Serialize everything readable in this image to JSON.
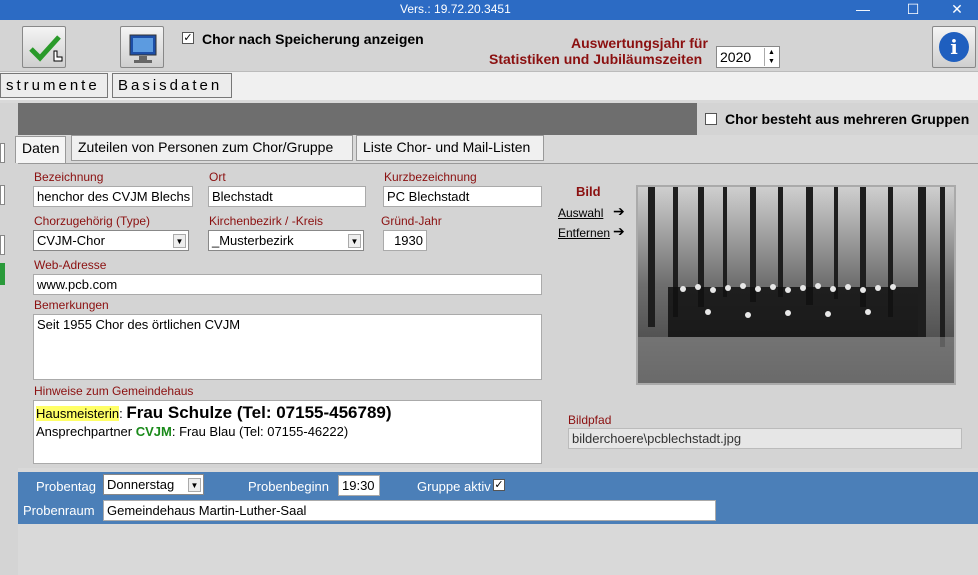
{
  "window": {
    "title": "Vers.: 19.72.20.3451"
  },
  "toolbar": {
    "show_after_save_label": "Chor nach Speicherung anzeigen",
    "show_after_save_checked": true,
    "eval_year_label_line1": "Auswertungsjahr für",
    "eval_year_label_line2": "Statistiken und Jubiläumszeiten",
    "eval_year": "2020",
    "info_symbol": "i"
  },
  "main_tabs": [
    "strumente",
    "Basisdaten"
  ],
  "multiple_groups_label": "Chor besteht aus mehreren Gruppen",
  "sub_tabs": [
    "Daten",
    "Zuteilen von Personen zum Chor/Gruppe",
    "Liste Chor- und Mail-Listen"
  ],
  "form": {
    "bezeichnung": {
      "label": "Bezeichnung",
      "value": "henchor des CVJM Blechs"
    },
    "ort": {
      "label": "Ort",
      "value": "Blechstadt"
    },
    "kurzbezeichnung": {
      "label": "Kurzbezeichnung",
      "value": "PC Blechstadt"
    },
    "chorzugehoerig": {
      "label": "Chorzugehörig (Type)",
      "value": "CVJM-Chor"
    },
    "kirchenbezirk": {
      "label": "Kirchenbezirk / -Kreis",
      "value": "_Musterbezirk"
    },
    "gruend_jahr": {
      "label": "Gründ-Jahr",
      "value": "1930"
    },
    "web": {
      "label": "Web-Adresse",
      "value": "www.pcb.com"
    },
    "bemerkungen": {
      "label": "Bemerkungen",
      "value": "Seit 1955 Chor des örtlichen CVJM"
    },
    "hinweise": {
      "label": "Hinweise zum Gemeindehaus",
      "line1_highlight": "Hausmeisterin",
      "line1_sep": ": ",
      "line1_bold": "Frau Schulze (Tel: 07155-456789)",
      "line2_prefix": "Ansprechpartner ",
      "line2_green": "CVJM",
      "line2_rest": ": Frau Blau (Tel: 07155-46222)"
    }
  },
  "bild": {
    "title": "Bild",
    "auswahl": "Auswahl",
    "entfernen": "Entfernen",
    "bildpfad_label": "Bildpfad",
    "bildpfad_value": "bilderchoere\\pcblechstadt.jpg"
  },
  "probe": {
    "probentag_label": "Probentag",
    "probentag_value": "Donnerstag",
    "probenbeginn_label": "Probenbeginn",
    "probenbeginn_value": "19:30",
    "gruppe_aktiv_label": "Gruppe aktiv",
    "gruppe_aktiv_checked": true,
    "probenraum_label": "Probenraum",
    "probenraum_value": "Gemeindehaus Martin-Luther-Saal"
  },
  "colors": {
    "label_red": "#8b1010",
    "blue_bar": "#4b7fb8",
    "title_bar": "#2c6bc4",
    "highlight": "#ffff66",
    "cvjm_green": "#1a8a1a"
  }
}
